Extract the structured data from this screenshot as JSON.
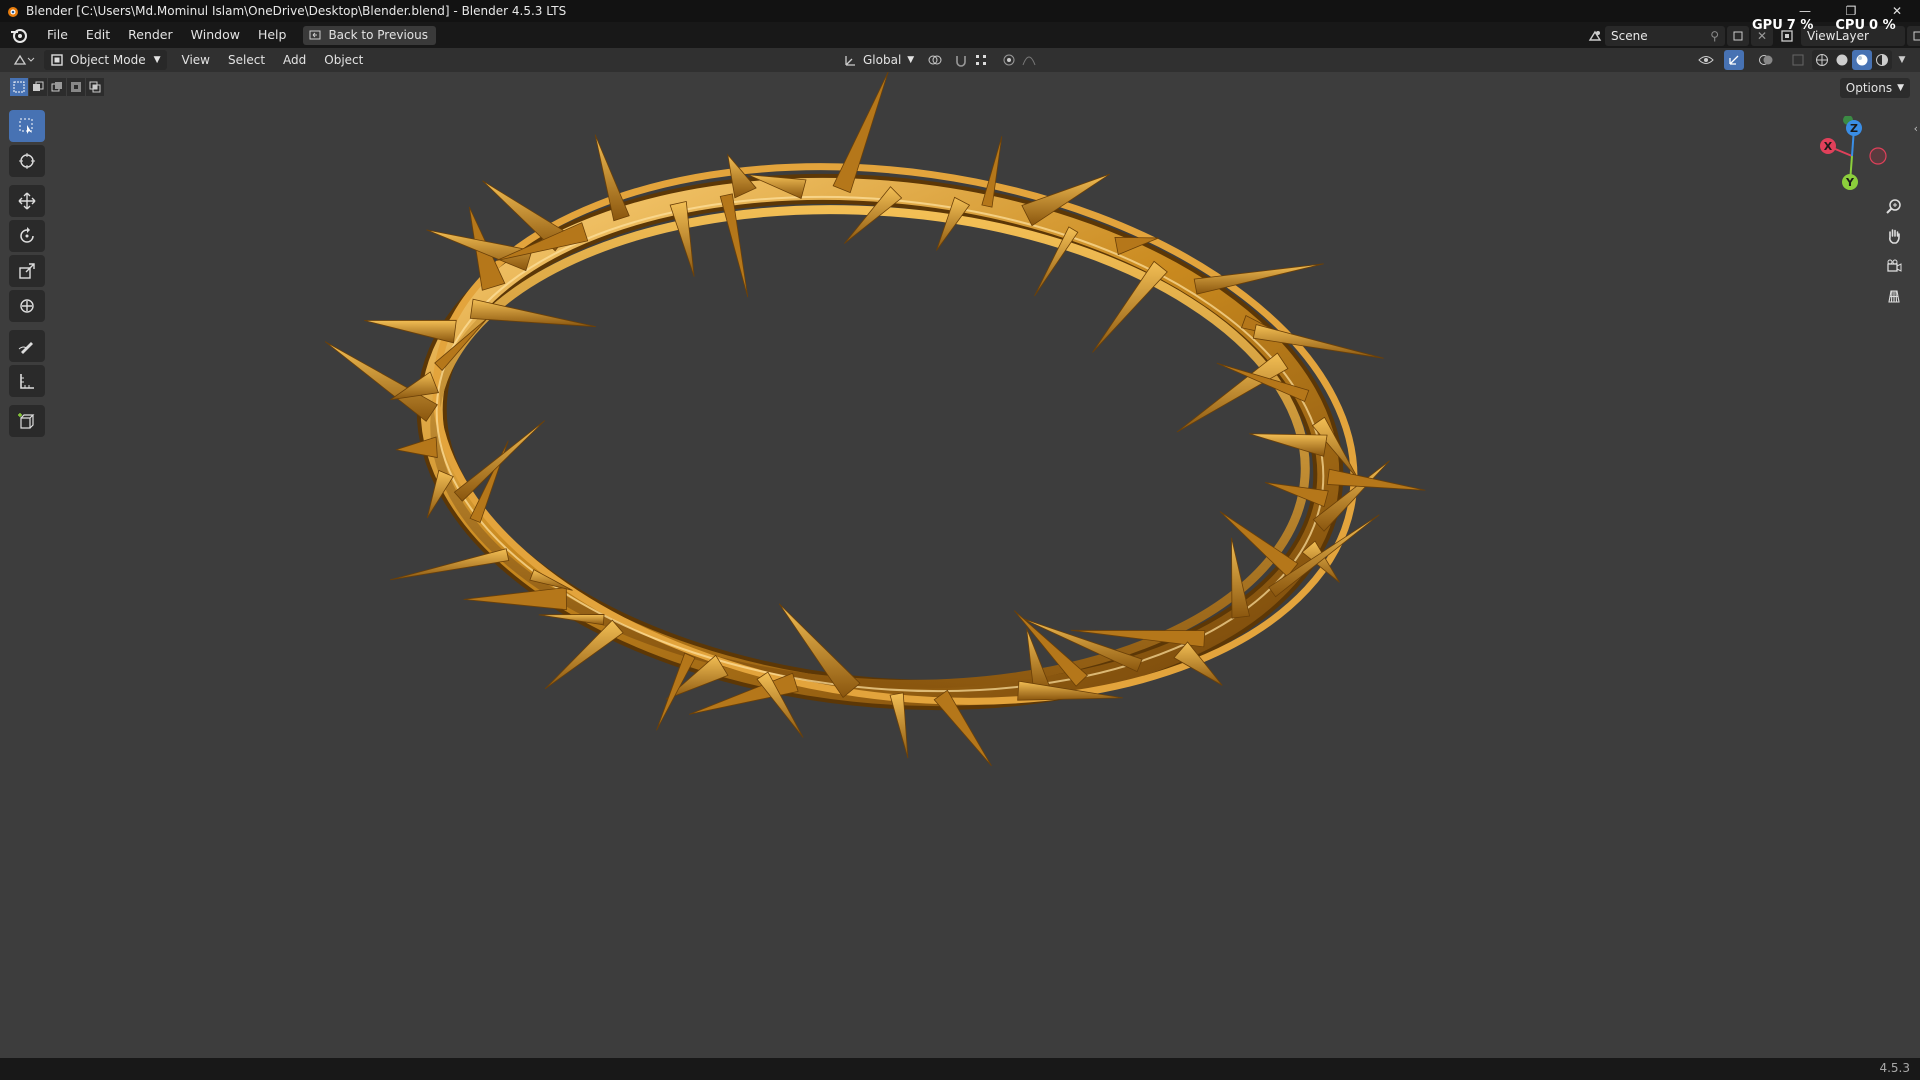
{
  "window": {
    "title": "Blender [C:\\Users\\Md.Mominul Islam\\OneDrive\\Desktop\\Blender.blend] - Blender 4.5.3 LTS",
    "minimize": "—",
    "restore": "❐",
    "close": "✕"
  },
  "menubar": {
    "items": [
      "File",
      "Edit",
      "Render",
      "Window",
      "Help"
    ],
    "back_button": "Back to Previous",
    "scene": "Scene",
    "view_layer": "ViewLayer"
  },
  "stats": {
    "gpu_label": "GPU",
    "gpu_value": "7 %",
    "cpu_label": "CPU",
    "cpu_value": "0 %"
  },
  "viewport_header": {
    "mode": "Object Mode",
    "menus": [
      "View",
      "Select",
      "Add",
      "Object"
    ],
    "transform_orientation": "Global",
    "options": "Options"
  },
  "toolbar": {
    "tools": [
      "select-box",
      "cursor",
      "move",
      "rotate",
      "scale",
      "transform",
      "annotate",
      "measure",
      "add-cube"
    ]
  },
  "gizmo": {
    "x": "X",
    "y": "Y",
    "z": "Z"
  },
  "status": {
    "version": "4.5.3"
  },
  "colors": {
    "accent": "#4772b3",
    "viewport_bg": "#3d3d3d",
    "gold": "#d9a030",
    "axis_x": "#e0405a",
    "axis_y": "#8ccf3c",
    "axis_z": "#3a8ee6"
  }
}
